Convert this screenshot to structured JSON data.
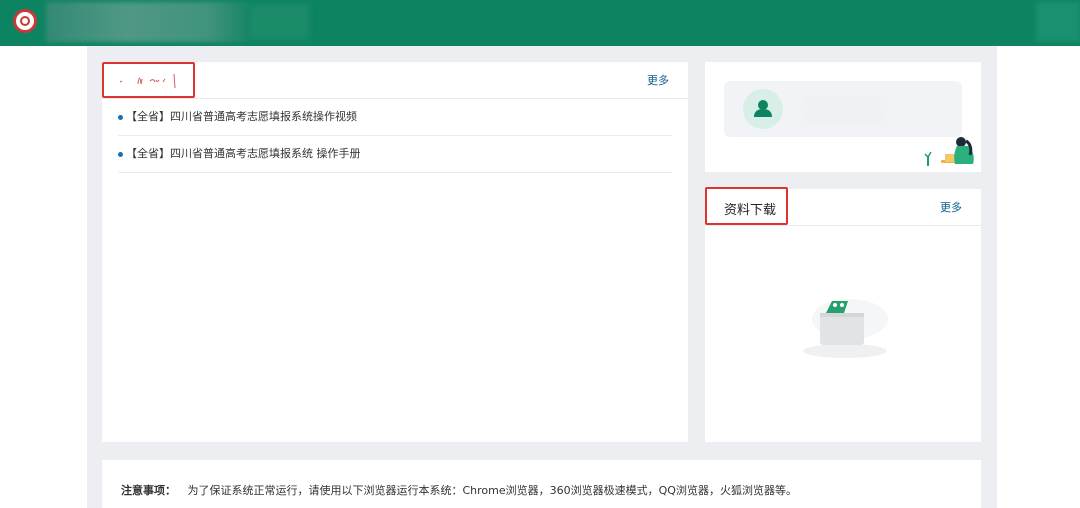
{
  "header": {
    "logo_icon": "emblem-icon",
    "accent_color": "#0d8461"
  },
  "notices_panel": {
    "more_label": "更多",
    "items": [
      {
        "label": "【全省】四川省普通高考志愿填报系统操作视频"
      },
      {
        "label": "【全省】四川省普通高考志愿填报系统 操作手册"
      }
    ]
  },
  "user_panel": {
    "avatar_icon": "user-icon"
  },
  "downloads_panel": {
    "title": "资料下载",
    "more_label": "更多",
    "empty_icon": "empty-box-icon"
  },
  "notice": {
    "label": "注意事项：",
    "text": "为了保证系统正常运行，请使用以下浏览器运行本系统：Chrome浏览器，360浏览器极速模式，QQ浏览器，火狐浏览器等。"
  }
}
